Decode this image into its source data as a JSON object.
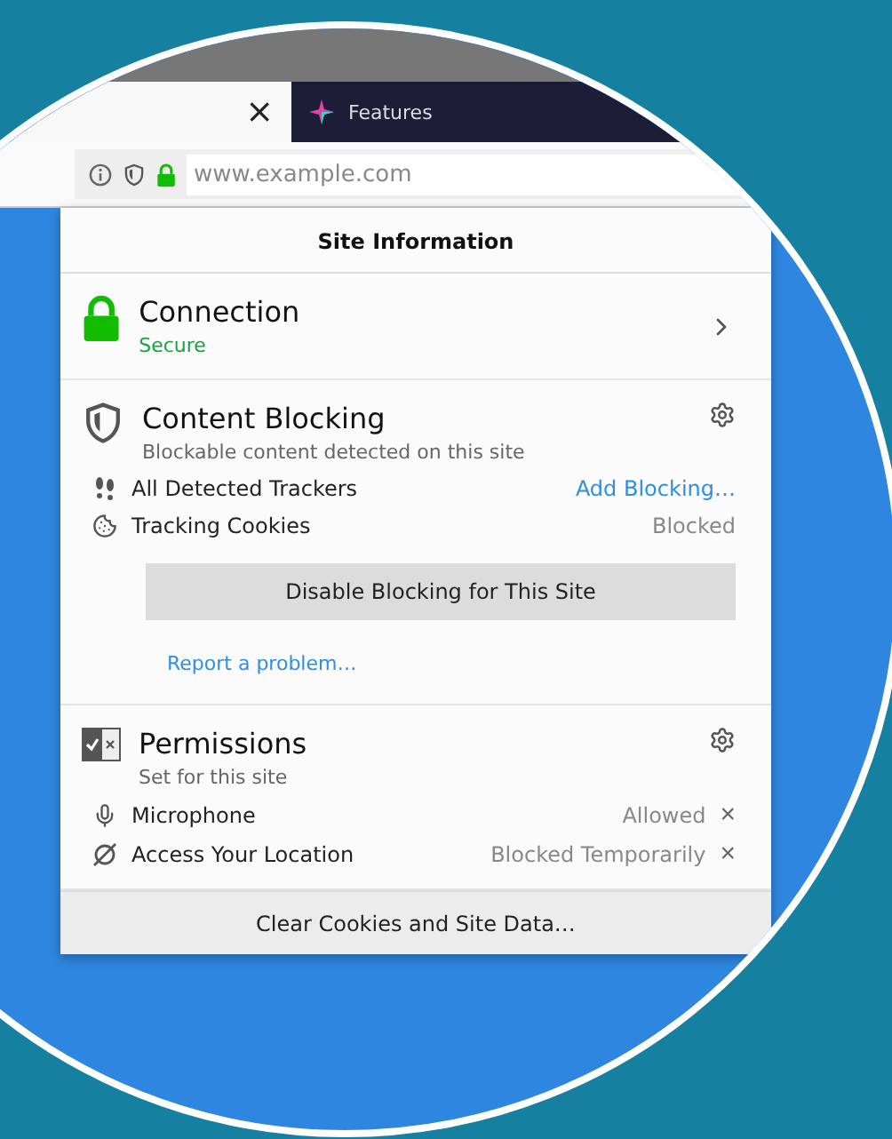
{
  "tabs": [
    {
      "kind": "current",
      "close": "×",
      "selected": true
    },
    {
      "kind": "other",
      "label": "Features",
      "selected": false
    }
  ],
  "address_bar": {
    "url": "www.example.com"
  },
  "panel": {
    "title": "Site Information",
    "connection": {
      "title": "Connection",
      "status": "Secure"
    },
    "content_blocking": {
      "title": "Content Blocking",
      "subtitle": "Blockable content detected on this site",
      "items": [
        {
          "kind": "trackers",
          "label": "All Detected Trackers",
          "link": "Add Blocking…"
        },
        {
          "kind": "cookies",
          "label": "Tracking Cookies",
          "status": "Blocked"
        }
      ],
      "button": "Disable Blocking for This Site",
      "report_link": "Report a problem…"
    },
    "permissions": {
      "title": "Permissions",
      "subtitle": "Set for this site",
      "items": [
        {
          "kind": "microphone",
          "label": "Microphone",
          "state": "Allowed",
          "remove": "×"
        },
        {
          "kind": "location",
          "label": "Access Your Location",
          "state": "Blocked Temporarily",
          "remove": "×"
        }
      ]
    },
    "footer_button": "Clear Cookies and Site Data…"
  }
}
